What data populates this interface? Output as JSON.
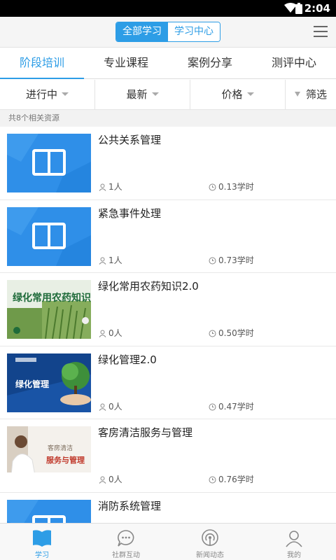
{
  "status_bar": {
    "time": "2:04"
  },
  "header": {
    "segments": [
      "全部学习",
      "学习中心"
    ],
    "active_segment": 0
  },
  "tabs": [
    "阶段培训",
    "专业课程",
    "案例分享",
    "测评中心"
  ],
  "filters": {
    "status": "进行中",
    "sort": "最新",
    "price": "价格",
    "filter": "筛选"
  },
  "result_count": "共8个相关资源",
  "courses": [
    {
      "title": "公共关系管理",
      "users": "1人",
      "hours": "0.13学时",
      "thumb": "book"
    },
    {
      "title": "紧急事件处理",
      "users": "1人",
      "hours": "0.73学时",
      "thumb": "book"
    },
    {
      "title": "绿化常用农药知识2.0",
      "users": "0人",
      "hours": "0.50学时",
      "thumb": "pesticide",
      "thumb_text": "绿化常用农药知识"
    },
    {
      "title": "绿化管理2.0",
      "users": "0人",
      "hours": "0.47学时",
      "thumb": "greening",
      "thumb_text": "绿化管理"
    },
    {
      "title": "客房清洁服务与管理",
      "users": "0人",
      "hours": "0.76学时",
      "thumb": "cleaning",
      "thumb_text_1": "客房清洁",
      "thumb_text_2": "服务与管理"
    },
    {
      "title": "消防系统管理",
      "users": "",
      "hours": "",
      "thumb": "book"
    }
  ],
  "bottom_nav": [
    {
      "label": "学习",
      "icon": "book-icon",
      "active": true
    },
    {
      "label": "社群互动",
      "icon": "chat-bubble-icon",
      "active": false
    },
    {
      "label": "新闻动态",
      "icon": "broadcast-icon",
      "active": false
    },
    {
      "label": "我的",
      "icon": "person-icon",
      "active": false
    }
  ],
  "colors": {
    "accent": "#2d9de6",
    "thumb_blue": "#2f8fe8"
  }
}
